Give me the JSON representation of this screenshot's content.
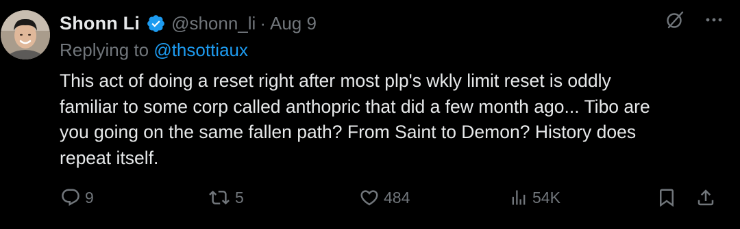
{
  "tweet": {
    "author": {
      "display_name": "Shonn Li",
      "handle": "@shonn_li",
      "verified": true
    },
    "separator": "·",
    "timestamp": "Aug 9",
    "replying_prefix": "Replying to",
    "replying_to": "@thsottiaux",
    "body_lines": [
      "This act of doing a reset right after most plp's wkly limit reset is oddly",
      "familiar to some corp called anthopric that did a few month ago... Tibo are",
      "you going on the same fallen path? From Saint to Demon? History does",
      "repeat itself."
    ],
    "actions": {
      "replies": "9",
      "reposts": "5",
      "likes": "484",
      "views": "54K"
    }
  },
  "colors": {
    "background": "#000000",
    "primary_text": "#e7e9ea",
    "secondary_text": "#71767b",
    "link": "#1d9bf0",
    "verified_badge": "#1d9bf0"
  },
  "icons": {
    "verified": "verified-badge-icon",
    "grok": "grok-icon",
    "more": "more-icon",
    "reply": "reply-icon",
    "repost": "repost-icon",
    "like": "heart-icon",
    "views": "views-icon",
    "bookmark": "bookmark-icon",
    "share": "share-icon"
  }
}
